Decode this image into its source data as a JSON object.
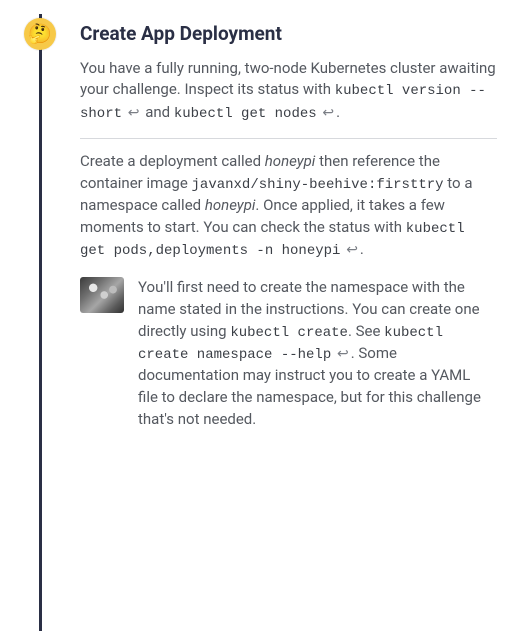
{
  "badge": {
    "emoji": "🤔"
  },
  "title": "Create App Deployment",
  "intro": {
    "text_a": "You have a fully running, two-node Kubernetes cluster awaiting your challenge. Inspect its status with ",
    "cmd1": "kubectl version --short",
    "text_b": " and ",
    "cmd2": "kubectl get nodes",
    "text_c": "."
  },
  "task": {
    "text_a": "Create a deployment called ",
    "em1": "honeypi",
    "text_b": " then reference the container image ",
    "cmd1": "javanxd/shiny-beehive:firsttry",
    "text_c": " to a namespace called ",
    "em2": "honeypi",
    "text_d": ". Once applied, it takes a few moments to start. You can check the status with ",
    "cmd2": "kubectl get pods,deployments -n honeypi",
    "text_e": "."
  },
  "hint": {
    "text_a": "You'll first need to create the namespace with the name stated in the instructions. You can create one directly using ",
    "cmd1": "kubectl create",
    "text_b": ". See ",
    "cmd2": "kubectl create namespace --help",
    "text_c": ". Some documentation may instruct you to create a YAML file to declare the namespace, but for this challenge that's not needed."
  },
  "glyph": {
    "return": "↩"
  }
}
